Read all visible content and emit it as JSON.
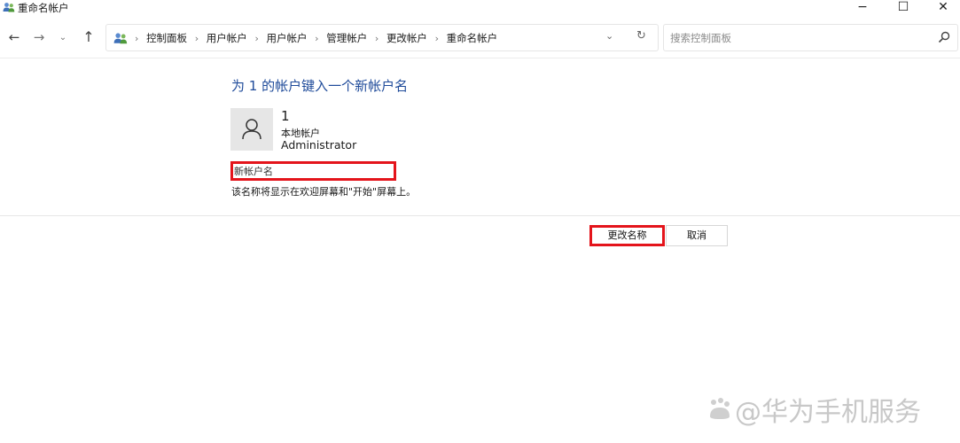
{
  "window": {
    "title": "重命名帐户",
    "minimize_glyph": "−",
    "maximize_glyph": "☐",
    "close_glyph": "✕"
  },
  "nav": {
    "back_glyph": "←",
    "forward_glyph": "→",
    "recent_glyph": "⌄",
    "up_glyph": "↑"
  },
  "address": {
    "breadcrumbs": [
      "控制面板",
      "用户帐户",
      "用户帐户",
      "管理帐户",
      "更改帐户",
      "重命名帐户"
    ],
    "separator": "›",
    "dropdown_glyph": "⌄",
    "refresh_glyph": "↻"
  },
  "search": {
    "placeholder": "搜索控制面板"
  },
  "main": {
    "heading": "为 1 的帐户键入一个新帐户名",
    "account": {
      "name": "1",
      "type": "本地帐户",
      "role": "Administrator"
    },
    "new_name_placeholder": "新帐户名",
    "hint": "该名称将显示在欢迎屏幕和\"开始\"屏幕上。"
  },
  "buttons": {
    "rename": "更改名称",
    "cancel": "取消"
  },
  "watermark": {
    "text": "@华为手机服务"
  },
  "colors": {
    "heading": "#1f4b9a",
    "highlight": "#e4141b"
  },
  "icons": [
    "users-icon",
    "user-avatar-icon",
    "search-icon"
  ]
}
